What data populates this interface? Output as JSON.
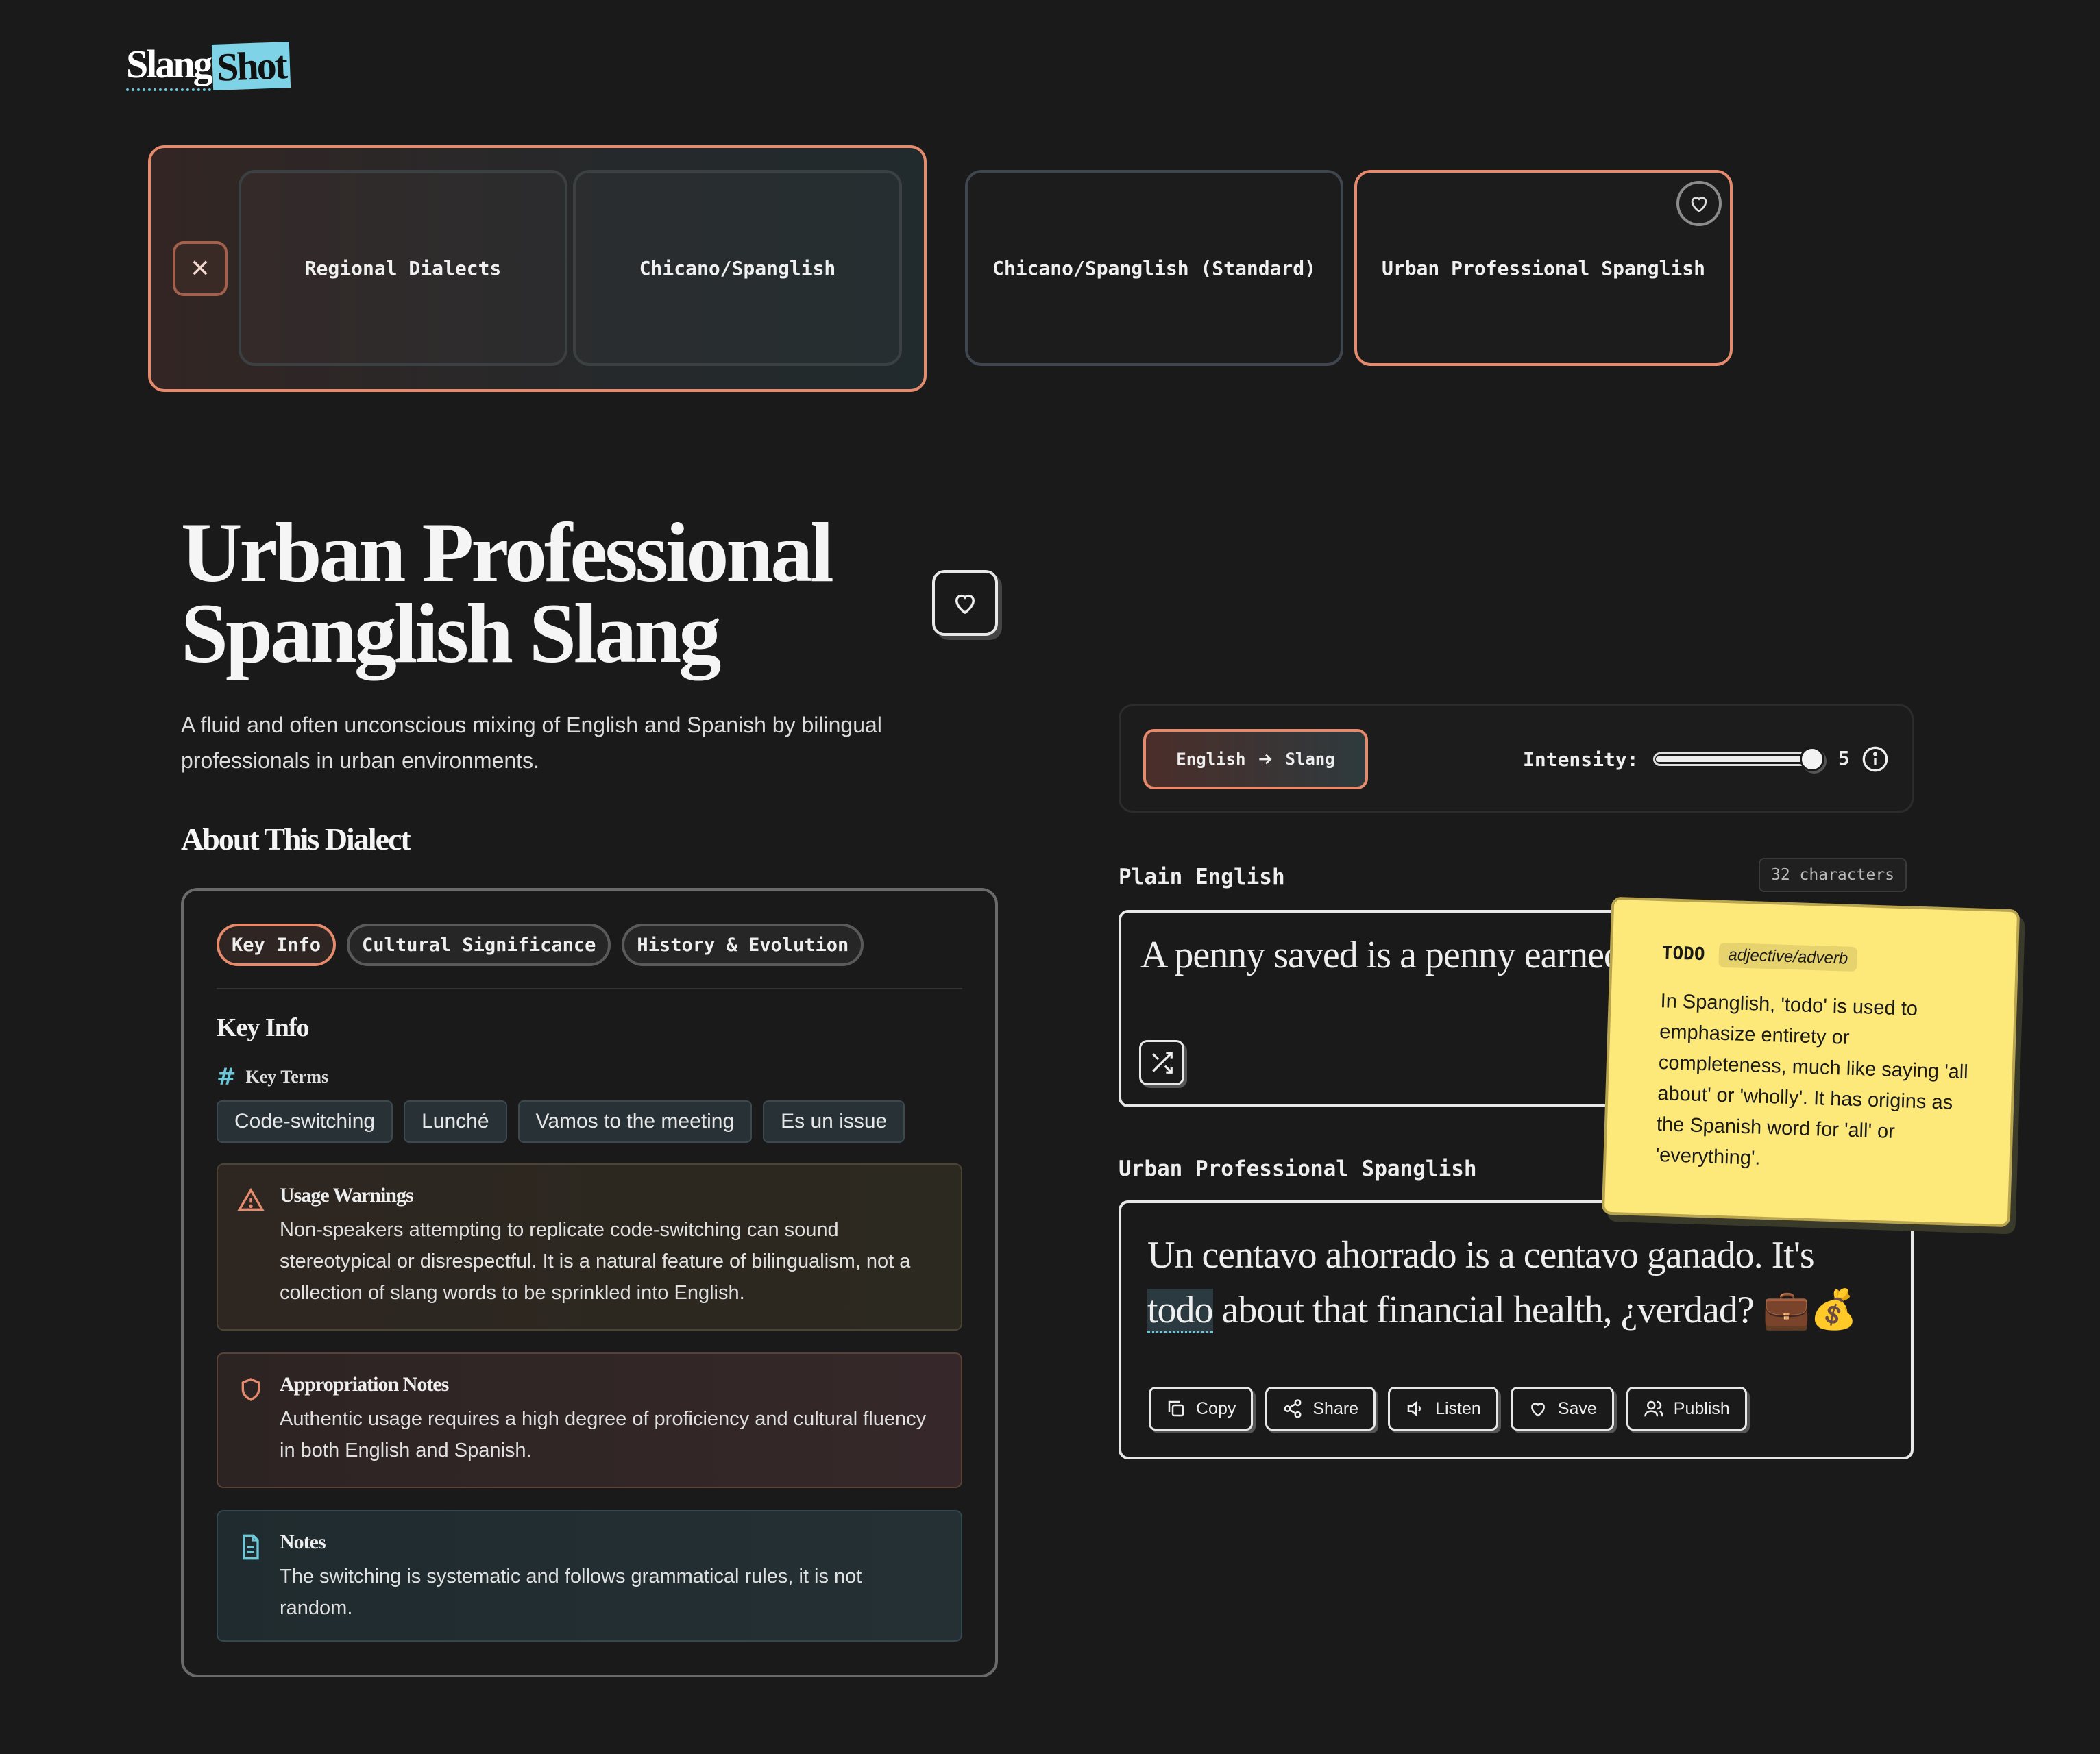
{
  "logo": {
    "part1": "Slang",
    "part2": "Shot"
  },
  "breadcrumb": {
    "items": [
      {
        "label": "Regional Dialects"
      },
      {
        "label": "Chicano/Spanglish"
      }
    ],
    "options": [
      {
        "label": "Chicano/Spanglish (Standard)",
        "active": false
      },
      {
        "label": "Urban Professional Spanglish",
        "active": true
      }
    ]
  },
  "header": {
    "title": "Urban Professional Spanglish Slang",
    "description": "A fluid and often unconscious mixing of English and Spanish by bilingual professionals in urban environments."
  },
  "about": {
    "heading": "About This Dialect",
    "tabs": [
      {
        "label": "Key Info",
        "active": true
      },
      {
        "label": "Cultural Significance",
        "active": false
      },
      {
        "label": "History & Evolution",
        "active": false
      }
    ],
    "key_info_heading": "Key Info",
    "key_terms_label": "Key Terms",
    "key_terms": [
      "Code-switching",
      "Lunché",
      "Vamos to the meeting",
      "Es un issue"
    ],
    "usage_warnings": {
      "title": "Usage Warnings",
      "text": "Non-speakers attempting to replicate code-switching can sound stereotypical or disrespectful. It is a natural feature of bilingualism, not a collection of slang words to be sprinkled into English."
    },
    "appropriation_notes": {
      "title": "Appropriation Notes",
      "text": "Authentic usage requires a high degree of proficiency and cultural fluency in both English and Spanish."
    },
    "notes": {
      "title": "Notes",
      "text": "The switching is systematic and follows grammatical rules, it is not random."
    }
  },
  "translator": {
    "direction": {
      "from": "English",
      "to": "Slang"
    },
    "intensity_label": "Intensity:",
    "intensity_value": "5",
    "intensity_fraction": 0.95,
    "input_label": "Plain English",
    "char_count": "32 characters",
    "input_text": "A penny saved is a penny earned.",
    "output_label": "Urban Professional Spanglish",
    "output_before": "Un centavo ahorrado is a centavo ganado. It's ",
    "output_highlight": "todo",
    "output_after": " about that financial health, ¿verdad? 💼💰",
    "actions": [
      "Copy",
      "Share",
      "Listen",
      "Save",
      "Publish"
    ]
  },
  "tooltip": {
    "word": "TODO",
    "part_of_speech": "adjective/adverb",
    "definition": "In Spanglish, 'todo' is used to emphasize entirety or completeness, much like saying 'all about' or 'wholly'. It has origins as the Spanish word for 'all' or 'everything'."
  },
  "colors": {
    "accent": "#e58a6c",
    "teal": "#6ec7d9",
    "tooltip_bg": "#fde97a",
    "background": "#1a1a1a"
  }
}
